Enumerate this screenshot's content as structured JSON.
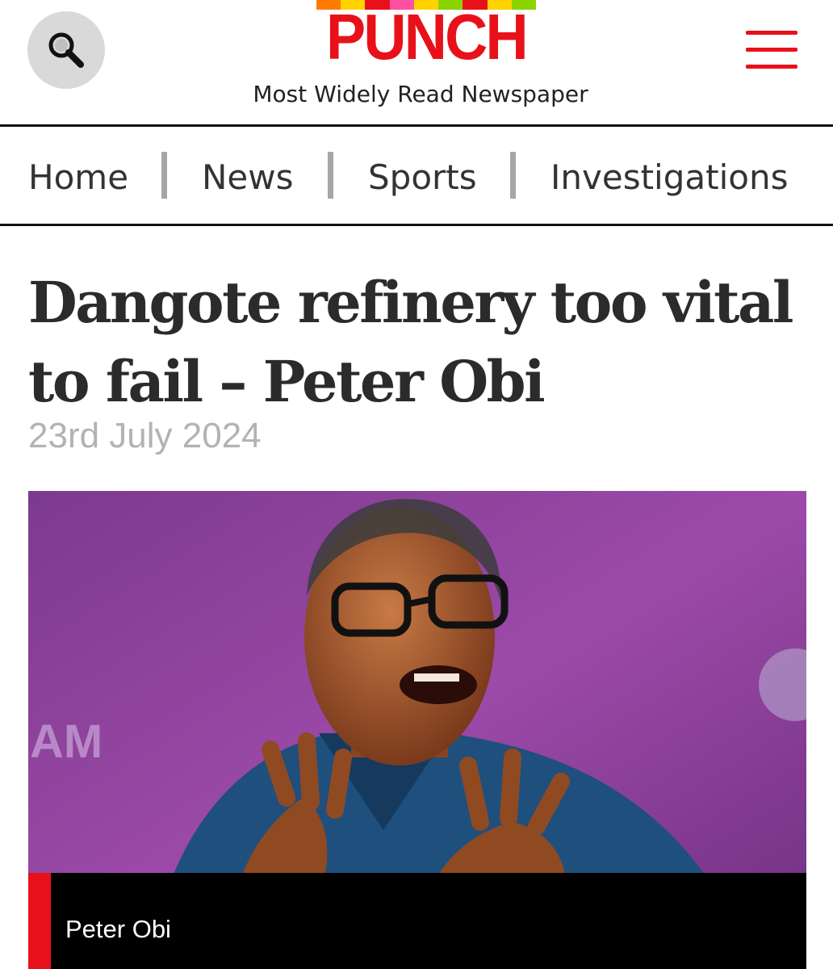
{
  "brand": {
    "name": "PUNCH",
    "tagline": "Most Widely Read Newspaper",
    "stripe_colors": [
      "#ff7a00",
      "#ffd200",
      "#e8111a",
      "#ff4fa0",
      "#ffd200",
      "#8bd400",
      "#e8111a",
      "#ffd200",
      "#8bd400"
    ],
    "accent_color": "#e8111a"
  },
  "header": {
    "search_icon": "search-icon",
    "menu_icon": "hamburger-menu-icon"
  },
  "nav": {
    "items": [
      {
        "label": "Home"
      },
      {
        "label": "News"
      },
      {
        "label": "Sports"
      },
      {
        "label": "Investigations"
      }
    ]
  },
  "article": {
    "headline": "Dangote refinery too vital to fail – Peter Obi",
    "date": "23rd July 2024",
    "image_caption": "Peter Obi"
  }
}
